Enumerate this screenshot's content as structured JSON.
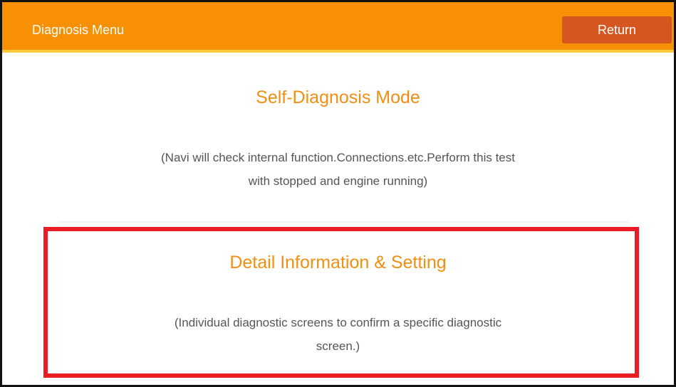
{
  "header": {
    "title": "Diagnosis Menu",
    "return_label": "Return"
  },
  "menu": {
    "items": [
      {
        "title": "Self-Diagnosis Mode",
        "description_line1": "(Navi will check internal function.Connections.etc.Perform this test",
        "description_line2": "with stopped and engine running)"
      },
      {
        "title": "Detail Information & Setting",
        "description_line1": "(Individual diagnostic screens to confirm a specific diagnostic",
        "description_line2": "screen.)"
      }
    ]
  },
  "colors": {
    "header_background": "#f79005",
    "header_accent_line": "#fbc93a",
    "return_button": "#d6561f",
    "option_title": "#f08f14",
    "highlight_border": "#ea1c24"
  }
}
